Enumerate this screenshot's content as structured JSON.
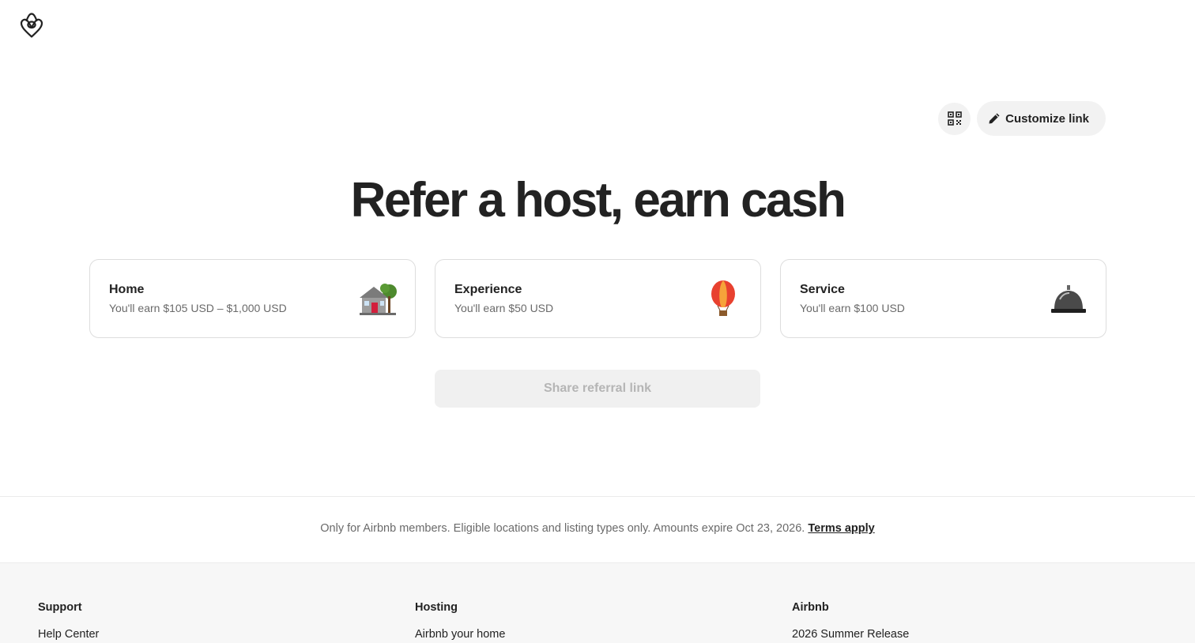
{
  "brand": {
    "logo_icon": "airbnb-logo-icon",
    "color": "#222222"
  },
  "actions": {
    "qr_icon": "qr-code-icon",
    "customize_icon": "pencil-icon",
    "customize_label": "Customize link"
  },
  "hero": {
    "title": "Refer a host, earn cash"
  },
  "cards": [
    {
      "title": "Home",
      "subtitle": "You'll earn $105 USD – $1,000 USD",
      "icon": "house-icon"
    },
    {
      "title": "Experience",
      "subtitle": "You'll earn $50 USD",
      "icon": "hot-air-balloon-icon"
    },
    {
      "title": "Service",
      "subtitle": "You'll earn $100 USD",
      "icon": "service-bell-icon"
    }
  ],
  "share": {
    "label": "Share referral link"
  },
  "disclaimer": {
    "text": "Only for Airbnb members. Eligible locations and listing types only. Amounts expire Oct 23, 2026. ",
    "link": "Terms apply"
  },
  "footer": {
    "columns": [
      {
        "heading": "Support",
        "links": [
          "Help Center"
        ]
      },
      {
        "heading": "Hosting",
        "links": [
          "Airbnb your home"
        ]
      },
      {
        "heading": "Airbnb",
        "links": [
          "2026 Summer Release"
        ]
      }
    ]
  },
  "colors": {
    "text": "#222222",
    "muted": "#6a6a6a",
    "surface": "#f2f2f2",
    "border": "#dddddd"
  }
}
